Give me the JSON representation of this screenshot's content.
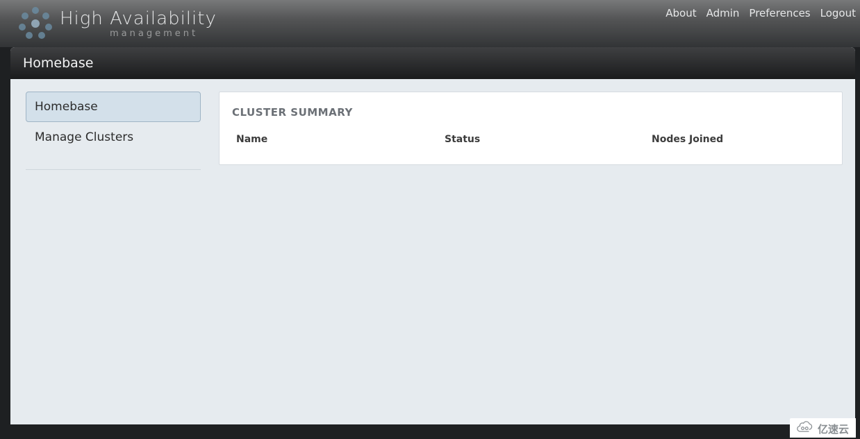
{
  "header": {
    "brand_title": "High Availability",
    "brand_subtitle": "management",
    "nav": [
      "About",
      "Admin",
      "Preferences",
      "Logout"
    ]
  },
  "titlebar": "Homebase",
  "sidebar": {
    "items": [
      {
        "label": "Homebase",
        "active": true
      },
      {
        "label": "Manage Clusters",
        "active": false
      }
    ]
  },
  "main": {
    "panel_title": "CLUSTER SUMMARY",
    "columns": [
      "Name",
      "Status",
      "Nodes Joined"
    ],
    "rows": []
  },
  "watermark": "亿速云"
}
